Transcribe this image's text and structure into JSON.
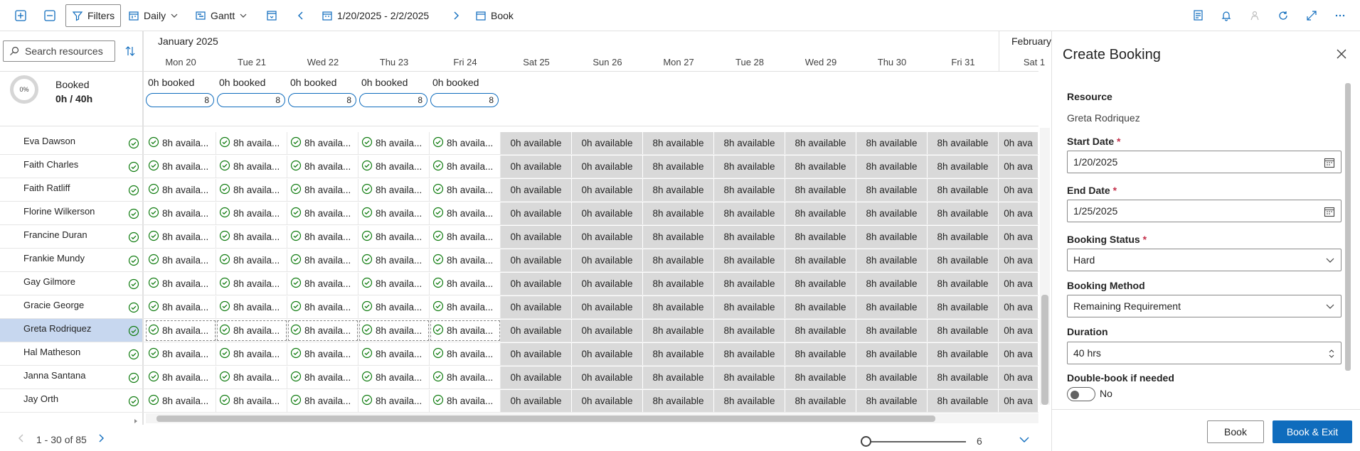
{
  "toolbar": {
    "filters_label": "Filters",
    "view_label": "Daily",
    "layout_label": "Gantt",
    "date_range": "1/20/2025 - 2/2/2025",
    "book_label": "Book"
  },
  "grid": {
    "search_placeholder": "Search resources",
    "months": [
      "January 2025",
      "February"
    ],
    "days": [
      "Mon 20",
      "Tue 21",
      "Wed 22",
      "Thu 23",
      "Fri 24",
      "Sat 25",
      "Sun 26",
      "Mon 27",
      "Tue 28",
      "Wed 29",
      "Thu 30",
      "Fri 31",
      "Sat 1"
    ],
    "summary": {
      "percent": "0%",
      "label": "Booked",
      "value": "0h / 40h"
    },
    "booked_cells": [
      {
        "text": "0h booked",
        "hours": "8"
      },
      {
        "text": "0h booked",
        "hours": "8"
      },
      {
        "text": "0h booked",
        "hours": "8"
      },
      {
        "text": "0h booked",
        "hours": "8"
      },
      {
        "text": "0h booked",
        "hours": "8"
      }
    ],
    "resources": [
      "Eva Dawson",
      "Faith Charles",
      "Faith Ratliff",
      "Florine Wilkerson",
      "Francine Duran",
      "Frankie Mundy",
      "Gay Gilmore",
      "Gracie George",
      "Greta Rodriquez",
      "Hal Matheson",
      "Janna Santana",
      "Jay Orth"
    ],
    "selected_resource": "Greta Rodriquez",
    "cells": [
      "8h availa...",
      "8h availa...",
      "8h availa...",
      "8h availa...",
      "8h availa...",
      "0h available",
      "0h available",
      "8h available",
      "8h available",
      "8h available",
      "8h available",
      "8h available",
      "0h ava"
    ],
    "pagination": "1 - 30 of 85",
    "zoom_value": "6"
  },
  "panel": {
    "title": "Create Booking",
    "resource_label": "Resource",
    "resource_value": "Greta Rodriquez",
    "start_label": "Start Date",
    "start_value": "1/20/2025",
    "end_label": "End Date",
    "end_value": "1/25/2025",
    "status_label": "Booking Status",
    "status_value": "Hard",
    "method_label": "Booking Method",
    "method_value": "Remaining Requirement",
    "duration_label": "Duration",
    "duration_value": "40 hrs",
    "double_label": "Double-book if needed",
    "double_value": "No",
    "required_mark": "*",
    "book_button": "Book",
    "book_exit_button": "Book & Exit"
  },
  "colors": {
    "accent": "#0f6cbd",
    "available_green": "#107c10",
    "unavailable_gray": "#d9d9d9",
    "selected_row": "#c7d7ef"
  }
}
